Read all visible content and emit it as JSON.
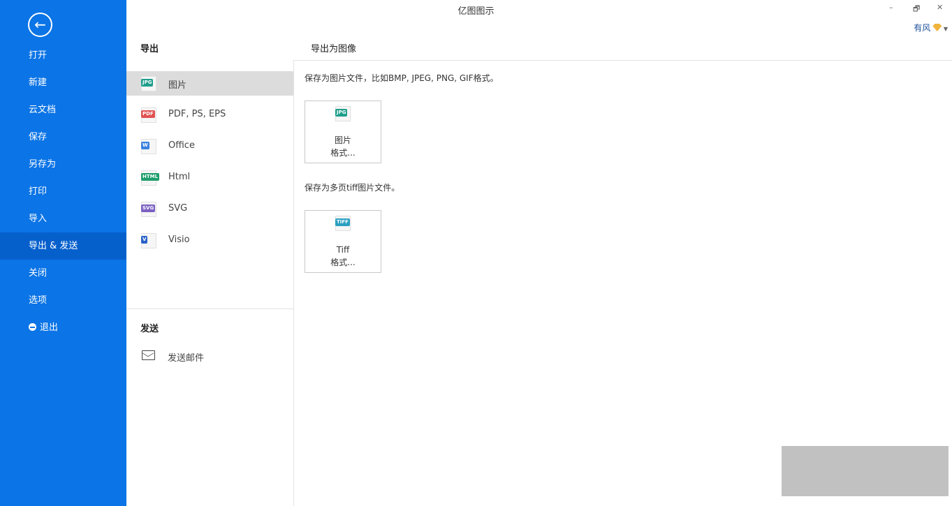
{
  "window": {
    "title": "亿图图示",
    "minimize": "–",
    "restore": "🗗",
    "close": "✕",
    "user": "有风"
  },
  "sidebar": {
    "back_icon": "arrow-left-icon",
    "items": [
      {
        "label": "打开"
      },
      {
        "label": "新建"
      },
      {
        "label": "云文档"
      },
      {
        "label": "保存"
      },
      {
        "label": "另存为"
      },
      {
        "label": "打印"
      },
      {
        "label": "导入"
      },
      {
        "label": "导出 & 发送",
        "selected": true
      },
      {
        "label": "关闭"
      },
      {
        "label": "选项"
      },
      {
        "label": "退出"
      }
    ]
  },
  "export": {
    "heading": "导出",
    "items": [
      {
        "label": "图片",
        "badge": "JPG",
        "color": "#1f9e8c",
        "selected": true
      },
      {
        "label": "PDF, PS, EPS",
        "badge": "PDF",
        "color": "#e05252"
      },
      {
        "label": "Office",
        "badge": "W",
        "color": "#3b82e0"
      },
      {
        "label": "Html",
        "badge": "HTML",
        "color": "#1f9e6c"
      },
      {
        "label": "SVG",
        "badge": "SVG",
        "color": "#7b61c2"
      },
      {
        "label": "Visio",
        "badge": "V",
        "color": "#2a62c9"
      }
    ]
  },
  "send": {
    "heading": "发送",
    "mail_label": "发送邮件"
  },
  "main": {
    "heading": "导出为图像",
    "desc1": "保存为图片文件，比如BMP, JPEG, PNG, GIF格式。",
    "card1": {
      "badge": "JPG",
      "line1": "图片",
      "line2": "格式..."
    },
    "desc2": "保存为多页tiff图片文件。",
    "card2": {
      "badge": "TIFF",
      "line1": "Tiff",
      "line2": "格式..."
    }
  }
}
